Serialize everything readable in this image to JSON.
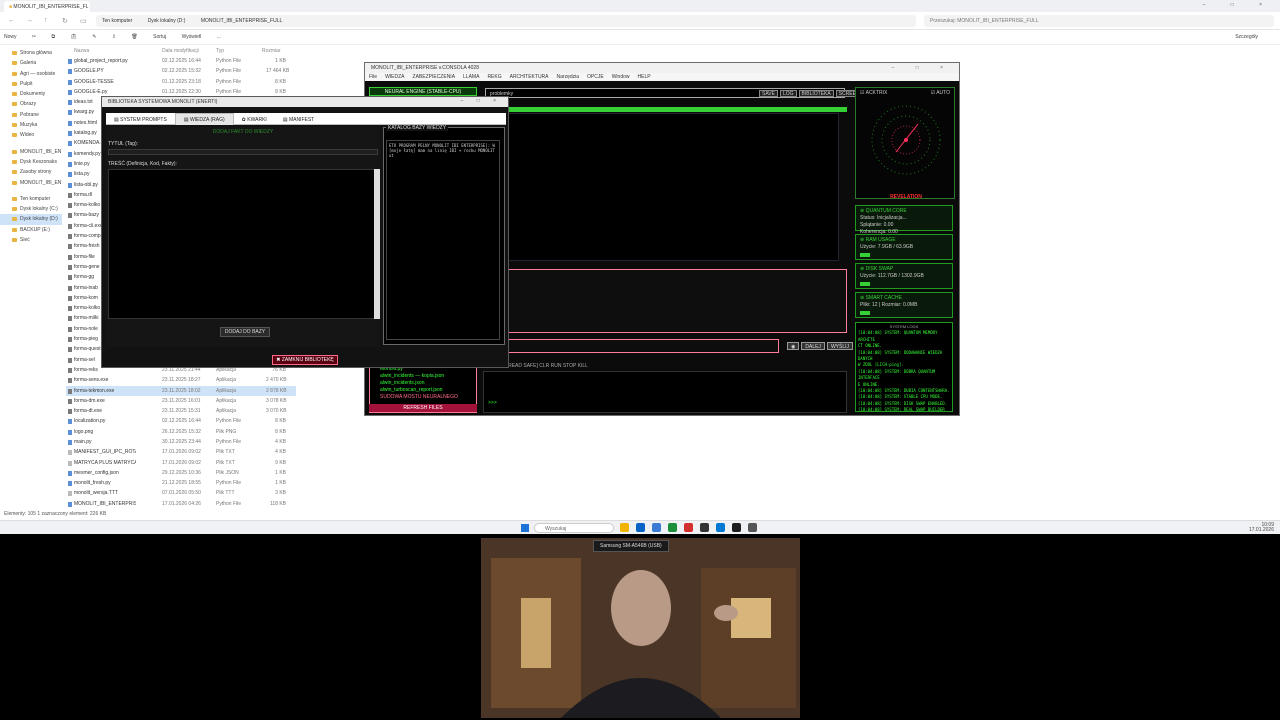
{
  "explorer": {
    "tab_title": "MONOLIT_IBI_ENTERPRISE_FL",
    "breadcrumb": [
      "Ten komputer",
      "Dysk lokalny (D:)",
      "MONOLIT_IBI_ENTERPRISE_FULL"
    ],
    "search_placeholder": "Przeszukaj: MONOLIT_IBI_ENTERPRISE_FULL",
    "commands": [
      "Nowy",
      "Sortuj",
      "Wyświetl",
      "..."
    ],
    "details_label": "Szczegóły",
    "columns": [
      "Nazwa",
      "Data modyfikacji",
      "Typ",
      "Rozmiar"
    ],
    "sidebar": [
      "Strona główna",
      "Galeria",
      "Agri — osobiste",
      "Pulpit",
      "Dokumenty",
      "Obrazy",
      "Pobrane",
      "Muzyka",
      "Wideo",
      "MONOLIT_IBI_ENTI",
      "Dysk Keszonaks",
      "Zasoby strony",
      "MONOLIT_IBI_ENT",
      "Ten komputer",
      "Dysk lokalny (C:)",
      "Dysk lokalny (D:)",
      "BACKUP (E:)",
      "Sieć"
    ],
    "files": [
      {
        "name": "global_project_report.py",
        "date": "02.12.2025 16:44",
        "type": "Python File",
        "size": "1 KB"
      },
      {
        "name": "GOOGLE.PY",
        "date": "02.12.2025 15:32",
        "type": "Python File",
        "size": "17 464 KB"
      },
      {
        "name": "GOOGLE-TESSE",
        "date": "01.12.2025 23:18",
        "type": "Python File",
        "size": "8 KB"
      },
      {
        "name": "GOOGLE-E.py",
        "date": "01.12.2025 22:30",
        "type": "Python File",
        "size": "8 KB"
      },
      {
        "name": "ideas.txt",
        "date": "28.11.2025 10:18",
        "type": "Python File",
        "size": "2 KB"
      },
      {
        "name": "kwarg.py",
        "date": "28.11.2025 10:18",
        "type": "Python File",
        "size": "2 KB"
      },
      {
        "name": "notes.html",
        "date": "27.11.2025 20:11",
        "type": "Python File",
        "size": "1 KB"
      },
      {
        "name": "katalog.py",
        "date": "27.11.2025 19:51",
        "type": "Python File",
        "size": "1 KB"
      },
      {
        "name": "KOMENDA.py",
        "date": "26.11.2025 14:02",
        "type": "Python File",
        "size": "3 KB"
      },
      {
        "name": "komendy.py",
        "date": "26.11.2025 13:44",
        "type": "Python File",
        "size": "2 KB"
      },
      {
        "name": "linie.py",
        "date": "25.11.2025 18:20",
        "type": "Python File",
        "size": "1 KB"
      },
      {
        "name": "lista.py",
        "date": "25.11.2025 18:19",
        "type": "Python File",
        "size": "3 KB"
      },
      {
        "name": "lista-obl.py",
        "date": "25.11.2025 16:05",
        "type": "Python File",
        "size": "2 KB"
      },
      {
        "name": "forma.dl",
        "date": "24.11.2025 12:55",
        "type": "Aplikacja",
        "size": "80 KB"
      },
      {
        "name": "forma-kolko",
        "date": "24.11.2025 12:40",
        "type": "Aplikacja",
        "size": "75 KB"
      },
      {
        "name": "forma-bazy",
        "date": "24.11.2025 12:31",
        "type": "Aplikacja",
        "size": "81 KB"
      },
      {
        "name": "forma-cli.exe",
        "date": "24.11.2025 12:12",
        "type": "Aplikacja",
        "size": "77 KB"
      },
      {
        "name": "forma-comp",
        "date": "24.11.2025 11:58",
        "type": "Aplikacja",
        "size": "79 KB"
      },
      {
        "name": "forma-fresh",
        "date": "24.11.2025 11:40",
        "type": "Aplikacja",
        "size": "83 KB"
      },
      {
        "name": "forma-file",
        "date": "24.11.2025 11:21",
        "type": "Aplikacja",
        "size": "82 KB"
      },
      {
        "name": "forma-gene",
        "date": "24.11.2025 11:02",
        "type": "Aplikacja",
        "size": "78 KB"
      },
      {
        "name": "forma-gg",
        "date": "24.11.2025 10:48",
        "type": "Aplikacja",
        "size": "80 KB"
      },
      {
        "name": "forma-inab",
        "date": "24.11.2025 10:30",
        "type": "Aplikacja",
        "size": "76 KB"
      },
      {
        "name": "forma-kom",
        "date": "24.11.2025 10:12",
        "type": "Aplikacja",
        "size": "79 KB"
      },
      {
        "name": "forma-kolko",
        "date": "24.11.2025 09:58",
        "type": "Aplikacja",
        "size": "81 KB"
      },
      {
        "name": "forma-milki",
        "date": "24.11.2025 09:40",
        "type": "Aplikacja",
        "size": "77 KB"
      },
      {
        "name": "forma-nole",
        "date": "24.11.2025 09:22",
        "type": "Aplikacja",
        "size": "80 KB"
      },
      {
        "name": "forma-pieg",
        "date": "24.11.2025 09:04",
        "type": "Aplikacja",
        "size": "78 KB"
      },
      {
        "name": "forma-quest",
        "date": "23.11.2025 22:40",
        "type": "Aplikacja",
        "size": "82 KB"
      },
      {
        "name": "forma-sel",
        "date": "23.11.2025 22:10",
        "type": "Aplikacja",
        "size": "79 KB"
      },
      {
        "name": "forma-reks",
        "date": "23.11.2025 21:44",
        "type": "Aplikacja",
        "size": "76 KB"
      },
      {
        "name": "forma-sens.exe",
        "date": "23.11.2025 18:27",
        "type": "Aplikacja",
        "size": "2 470 KB"
      },
      {
        "name": "forma-tekmon.exe",
        "date": "23.11.2025 18:02",
        "type": "Aplikacja",
        "size": "2 878 KB"
      },
      {
        "name": "forma-dm.exe",
        "date": "23.11.2025 16:01",
        "type": "Aplikacja",
        "size": "3 078 KB"
      },
      {
        "name": "forma-dt.exe",
        "date": "23.11.2025 15:31",
        "type": "Aplikacja",
        "size": "3 070 KB"
      },
      {
        "name": "localization.py",
        "date": "02.12.2025 16:44",
        "type": "Python File",
        "size": "8 KB"
      },
      {
        "name": "logo.png",
        "date": "26.12.2025 15:32",
        "type": "Plik PNG",
        "size": "8 KB"
      },
      {
        "name": "main.py",
        "date": "30.12.2025 23:44",
        "type": "Python File",
        "size": "4 KB"
      },
      {
        "name": "MANIFEST_GUI_IPC_ROTATOR",
        "date": "17.01.2026 09:02",
        "type": "Plik TXT",
        "size": "4 KB"
      },
      {
        "name": "MATRYCA PLUS MATRYCA MINUS MAT...",
        "date": "17.01.2026 09:02",
        "type": "Plik TXT",
        "size": "9 KB"
      },
      {
        "name": "mesmer_config.json",
        "date": "29.12.2025 10:36",
        "type": "Plik JSON",
        "size": "1 KB"
      },
      {
        "name": "monolit_fresh.py",
        "date": "21.12.2025 18:55",
        "type": "Python File",
        "size": "1 KB"
      },
      {
        "name": "monolit_wersja.TTT",
        "date": "07.01.2026 05:50",
        "type": "Plik TTT",
        "size": "3 KB"
      },
      {
        "name": "MONOLIT_IBI_ENTERPRISE - kopia.PY",
        "date": "17.01.2026 04:26",
        "type": "Python File",
        "size": "118 KB"
      },
      {
        "name": "MONOLIT_IBI_ENTERPRISE.PY",
        "date": "17.01.2026 06:50",
        "type": "Python File",
        "size": "118 KB"
      },
      {
        "name": "MONOLIT_IBI_ENTERPRISE.PY",
        "date": "17.01.2026 06:50",
        "type": "Python File",
        "size": "118 KB"
      }
    ],
    "selected_index": 32,
    "status": "Elementy: 105     1 zaznaczony element: 226 KB"
  },
  "taskbar": {
    "search_placeholder": "Wyszukaj",
    "time": "10:09",
    "date": "17.01.2026",
    "icon_colors": [
      "#f0b400",
      "#0a64c8",
      "#3a7bd5",
      "#1b8f3a",
      "#d42f2f",
      "#333333",
      "#0078d4",
      "#1e1e1e",
      "#555555"
    ]
  },
  "console": {
    "title": "MONOLIT_IBI_ENTERPRISE v.CONSOLA 4028",
    "menu": [
      "File",
      "WIEDZA",
      "ZABEZPIECZENIA",
      "LLAMA",
      "REKG",
      "ARCHITEKTURA",
      "Narzędzia",
      "OPCJE",
      "Window",
      "HELP"
    ],
    "neural_engine": "NEURAL ENGINE (STABLE-CPU)",
    "prompt_value": "problemky",
    "top_buttons": [
      "SAVE",
      "LOG",
      "BIBLIOTEKA",
      "SCREEN",
      "WIEDZA(SAG)"
    ],
    "send_buttons": [
      "DALEJ",
      "WYŚLIJ"
    ],
    "files": [
      "Monolit.py",
      "alwin_incidents — kopia.json",
      "alwin_incidents.json",
      "alwin_turboscan_report.json",
      "SUDOWA MOSTU NEURALNEGO"
    ],
    "refresh_label": "REFRESH FILES",
    "terminal_header": "SHELL [THREAD SAFE]  CLR  RUN  STOP  KILL",
    "terminal_prompt": ">>>",
    "radar_toggle_left": "ACKTRIX",
    "radar_toggle_right": "AUTO",
    "revelation_label": "REVELATION",
    "modules": [
      {
        "title": "QUANTUM CORE",
        "line1": "Status: Inicjalizacja...",
        "line2": "Splątanie: 0.00",
        "line3": "Koherencja: 0.00"
      },
      {
        "title": "RAM USAGE",
        "line1": "Użycie: 7.9GB / 63.9GB",
        "line2": "",
        "line3": ""
      },
      {
        "title": "DISK SWAP",
        "line1": "Użycie: 112.7GB / 1302.9GB",
        "line2": "",
        "line3": ""
      },
      {
        "title": "SMART CACHE",
        "line1": "Pliki: 12 | Rozmiar: 0.0MB",
        "line2": "",
        "line3": ""
      }
    ],
    "logs_title": "SYSTEM LOGS",
    "logs": [
      "[10:04:08] SYSTEM: QUANTUM MEMORY ARCHITE",
      "CT ONLINE.",
      "[10:04:08] SYSTEM: DODAWANIE WIEDZA DANYCH",
      "W ZDOL [LICH-ping].",
      "[10:04:08] SYSTEM: DOBRA QUANTUM INTERFACE",
      "E ONLINE.",
      "[10:04:08] SYSTEM: DUBIA CONTENTSHARA.",
      "[10:04:08] SYSTEM: STABLE CPU MODE.",
      "[10:04:08] SYSTEM: DISK SWAP ENABLED.",
      "[10:04:08] SYSTEM: REAL SWAP BUILDER ONLINE",
      "E.",
      "[10:04:08] SYSTEM: TURBO EDITOR BUILT-IN.",
      "[10:04:08] SYSTEM: OPCJE ZAŁADOWANE.",
      "[10:04:08] SYSTEM: TRIGGER 1 LOGO SYSTEM",
      "READY."
    ]
  },
  "dialog": {
    "title": "BIBLIOTEKA SYSTEMOWA MONOLIT (ENERTI)",
    "tabs": [
      "SYSTEM PROMPTS",
      "WIEDZA (RAG)",
      "KWARKI",
      "MANIFEST"
    ],
    "active_tab": 1,
    "subtitle": "DODAJ FAKT DO WIEDZY",
    "tytul_label": "TYTUŁ (Tag):",
    "tresc_label": "TREŚĆ (Definicja, Kod, Fakty):",
    "add_button": "DODAJ DO BAZY",
    "catalog_label": "KATALOG BAZY WIEDZY",
    "catalog_items": [
      "ETO PROGRAM PELNY MONOLIT IBI ENTERPRISE]: W",
      "[moje łatę] mam na linię IBI + rocku MONOLIT ut"
    ],
    "close_button": "ZAMKNIJ BIBLIOTEKĘ"
  },
  "webcam": {
    "device_label": "Samsung SM-A546B (USB)"
  }
}
